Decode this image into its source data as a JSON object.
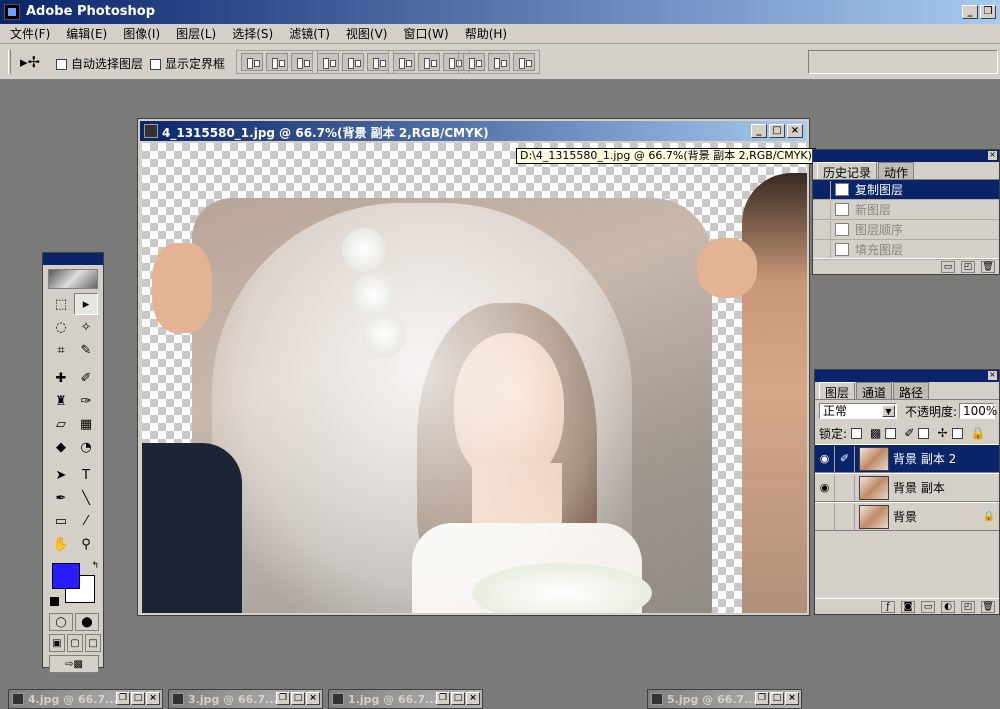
{
  "app": {
    "title": "Adobe Photoshop",
    "window_buttons": {
      "minimize": "_",
      "restore": "❐"
    }
  },
  "menu": [
    "文件(F)",
    "编辑(E)",
    "图像(I)",
    "图层(L)",
    "选择(S)",
    "滤镜(T)",
    "视图(V)",
    "窗口(W)",
    "帮助(H)"
  ],
  "options_bar": {
    "tool_icon": "move-tool-icon",
    "auto_select_label": "自动选择图层",
    "show_bounds_label": "显示定界框"
  },
  "document": {
    "title": "4_1315580_1.jpg @ 66.7%(背景 副本 2,RGB/CMYK)",
    "tooltip": "D:\\4_1315580_1.jpg @ 66.7%(背景 副本 2,RGB/CMYK)",
    "buttons": {
      "minimize": "_",
      "maximize": "□",
      "close": "×"
    }
  },
  "history_panel": {
    "tabs": [
      "历史记录",
      "动作"
    ],
    "active_tab": 0,
    "items": [
      {
        "label": "复制图层",
        "state": "active"
      },
      {
        "label": "新图层",
        "state": "dim"
      },
      {
        "label": "图层顺序",
        "state": "dim"
      },
      {
        "label": "填充图层",
        "state": "dim"
      }
    ]
  },
  "layers_panel": {
    "tabs": [
      "图层",
      "通道",
      "路径"
    ],
    "active_tab": 0,
    "blend_mode": "正常",
    "opacity_label": "不透明度:",
    "opacity_value": "100%",
    "lock_label": "锁定:",
    "layers": [
      {
        "name": "背景 副本 2",
        "visible": true,
        "active": true
      },
      {
        "name": "背景 副本",
        "visible": true,
        "active": false
      },
      {
        "name": "背景",
        "visible": false,
        "active": false,
        "locked": true
      }
    ]
  },
  "minimized_windows": [
    {
      "title": "4.jpg @ 66.7..."
    },
    {
      "title": "3.jpg @ 66.7..."
    },
    {
      "title": "1.jpg @ 66.7..."
    },
    {
      "title": "5.jpg @ 66.7..."
    }
  ],
  "colors": {
    "foreground": "#2a1aff",
    "background": "#ffffff",
    "titlebar_active": "#0a246a",
    "workspace": "#7a7a7a"
  }
}
